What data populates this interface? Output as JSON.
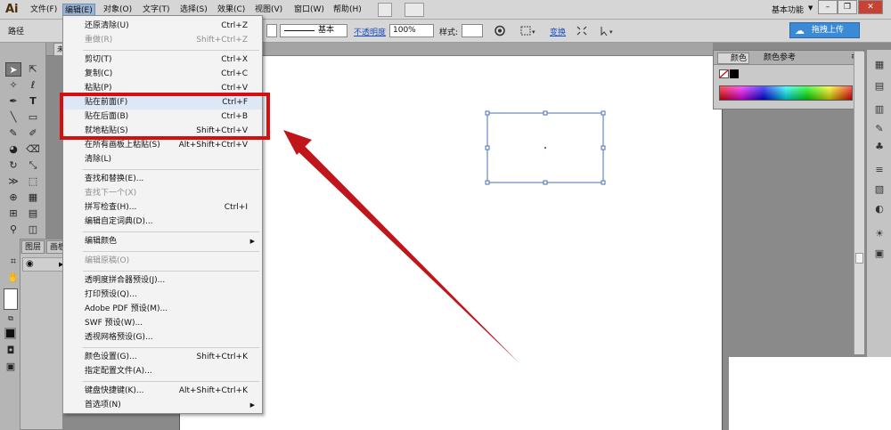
{
  "app": {
    "logo": "Ai"
  },
  "menubar": {
    "items": [
      "文件(F)",
      "编辑(E)",
      "对象(O)",
      "文字(T)",
      "选择(S)",
      "效果(C)",
      "视图(V)",
      "窗口(W)",
      "帮助(H)"
    ],
    "workspace": "基本功能"
  },
  "controlbar": {
    "label": "路径",
    "stroke_style": "基本",
    "opacity_label": "不透明度",
    "opacity_value": "100%",
    "style_label": "样式:",
    "transform_label": "变换",
    "upload_label": "拖拽上传"
  },
  "document": {
    "tab": "未"
  },
  "layers_panel": {
    "tabs": [
      "图层",
      "画板"
    ]
  },
  "color_panel": {
    "tabs": [
      "颜色",
      "颜色参考"
    ]
  },
  "edit_menu": {
    "items": [
      {
        "label": "还原清除(U)",
        "shortcut": "Ctrl+Z",
        "disabled": false
      },
      {
        "label": "重做(R)",
        "shortcut": "Shift+Ctrl+Z",
        "disabled": true
      },
      {
        "label": "剪切(T)",
        "shortcut": "Ctrl+X",
        "disabled": false
      },
      {
        "label": "复制(C)",
        "shortcut": "Ctrl+C",
        "disabled": false
      },
      {
        "label": "粘贴(P)",
        "shortcut": "Ctrl+V",
        "disabled": false
      },
      {
        "label": "贴在前面(F)",
        "shortcut": "Ctrl+F",
        "disabled": false
      },
      {
        "label": "贴在后面(B)",
        "shortcut": "Ctrl+B",
        "disabled": false
      },
      {
        "label": "就地粘贴(S)",
        "shortcut": "Shift+Ctrl+V",
        "disabled": false
      },
      {
        "label": "在所有画板上粘贴(S)",
        "shortcut": "Alt+Shift+Ctrl+V",
        "disabled": false
      },
      {
        "label": "清除(L)",
        "shortcut": "",
        "disabled": false
      },
      {
        "label": "查找和替换(E)...",
        "shortcut": "",
        "disabled": false
      },
      {
        "label": "查找下一个(X)",
        "shortcut": "",
        "disabled": true
      },
      {
        "label": "拼写检查(H)...",
        "shortcut": "Ctrl+I",
        "disabled": false
      },
      {
        "label": "编辑自定词典(D)...",
        "shortcut": "",
        "disabled": false
      },
      {
        "label": "编辑颜色",
        "shortcut": "",
        "disabled": false
      },
      {
        "label": "编辑原稿(O)",
        "shortcut": "",
        "disabled": true
      },
      {
        "label": "透明度拼合器预设(J)...",
        "shortcut": "",
        "disabled": false
      },
      {
        "label": "打印预设(Q)...",
        "shortcut": "",
        "disabled": false
      },
      {
        "label": "Adobe PDF 预设(M)...",
        "shortcut": "",
        "disabled": false
      },
      {
        "label": "SWF 预设(W)...",
        "shortcut": "",
        "disabled": false
      },
      {
        "label": "透视网格预设(G)...",
        "shortcut": "",
        "disabled": false
      },
      {
        "label": "颜色设置(G)...",
        "shortcut": "Shift+Ctrl+K",
        "disabled": false
      },
      {
        "label": "指定配置文件(A)...",
        "shortcut": "",
        "disabled": false
      },
      {
        "label": "键盘快捷键(K)...",
        "shortcut": "Alt+Shift+Ctrl+K",
        "disabled": false
      },
      {
        "label": "首选项(N)",
        "shortcut": "",
        "disabled": false
      }
    ]
  },
  "colors": {
    "highlight_box": "#d40f0f",
    "arrow": "#c0151a",
    "selection": "#4a6fb5"
  }
}
